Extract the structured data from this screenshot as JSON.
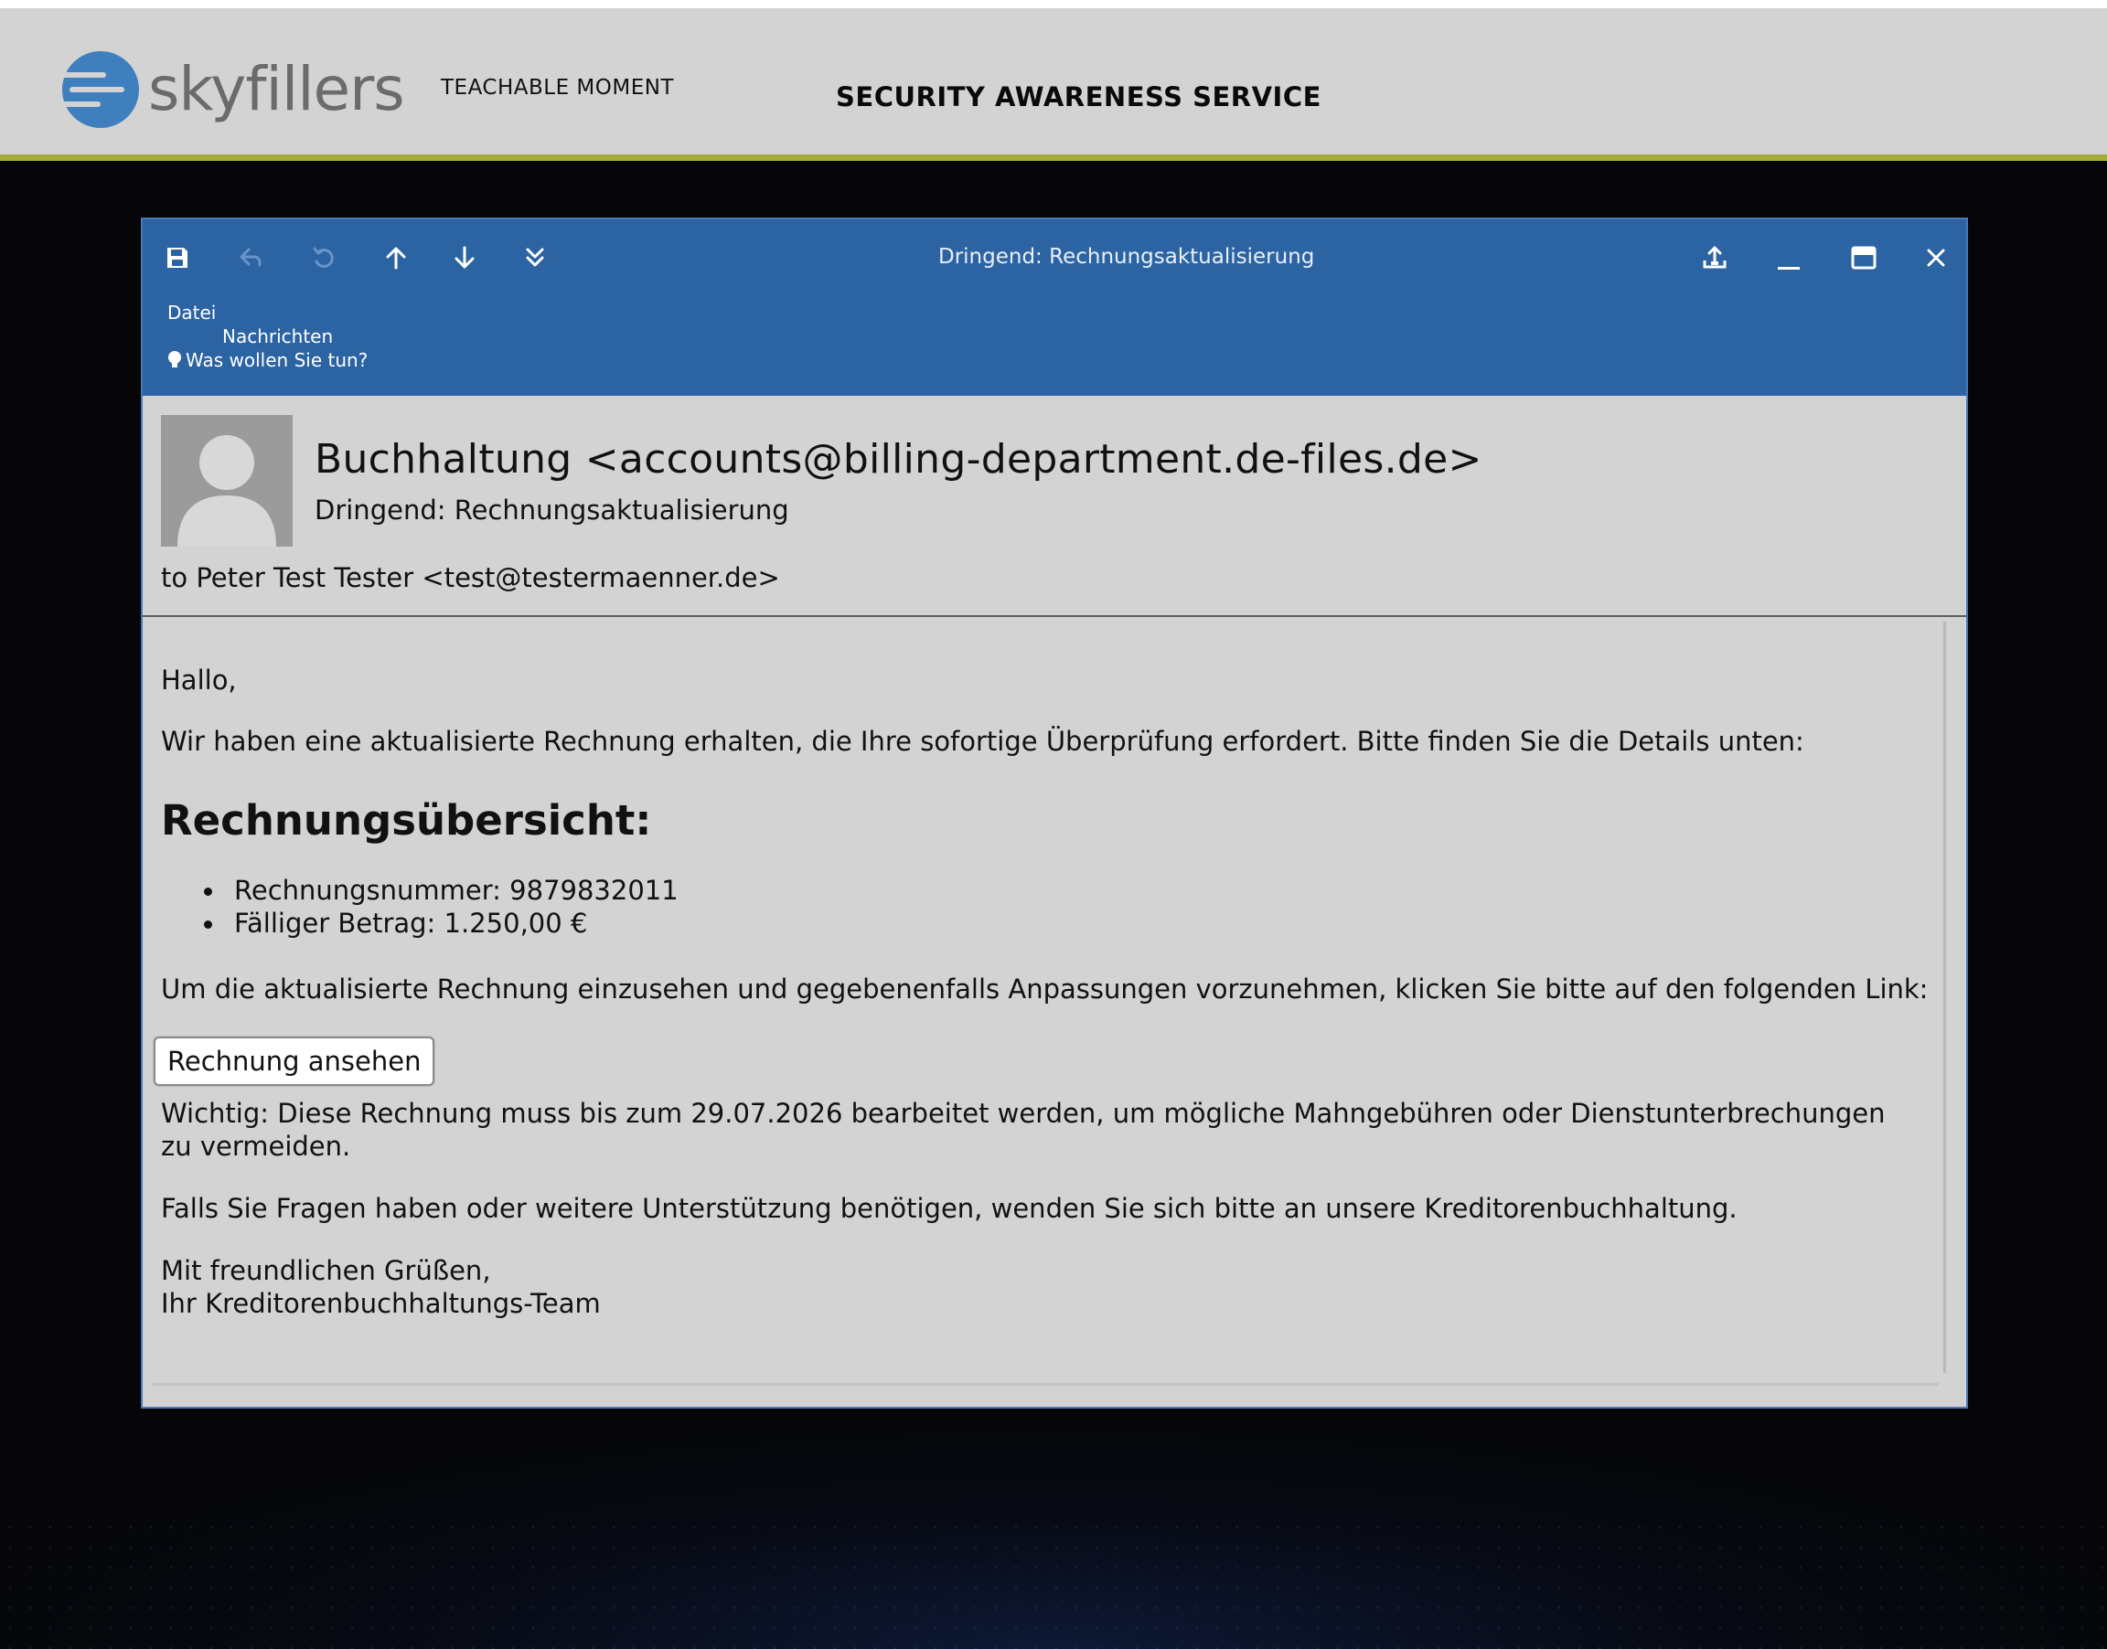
{
  "header": {
    "logo_text": "skyfillers",
    "teachable_moment": "TEACHABLE MOMENT",
    "service_title": "SECURITY AWARENESS SERVICE",
    "accent_color": "#a4ad3a",
    "logo_color": "#3f7fbe"
  },
  "window": {
    "title": "Dringend: Rechnungsaktualisierung",
    "toolbar_icons": [
      "save-icon",
      "undo-icon",
      "redo-icon",
      "arrow-up-icon",
      "arrow-down-icon",
      "double-chevron-down-icon"
    ],
    "window_icons": [
      "share-icon",
      "minimize-icon",
      "maximize-icon",
      "close-icon"
    ],
    "menu": {
      "file": "Datei",
      "messages": "Nachrichten",
      "tell_me": "Was wollen Sie tun?"
    },
    "titlebar_color": "#2c64a3"
  },
  "message": {
    "from": "Buchhaltung <accounts@billing-department.de-files.de>",
    "subject": "Dringend: Rechnungsaktualisierung",
    "to": "to Peter Test Tester <test@testermaenner.de>"
  },
  "body": {
    "greeting": "Hallo,",
    "intro": "Wir haben eine aktualisierte Rechnung erhalten, die Ihre sofortige Überprüfung erfordert. Bitte finden Sie die Details unten:",
    "heading": "Rechnungsübersicht:",
    "items": [
      "Rechnungsnummer: 9879832011",
      "Fälliger Betrag: 1.250,00 €"
    ],
    "cta_text": "Um die aktualisierte Rechnung einzusehen und gegebenenfalls Anpassungen vorzunehmen, klicken Sie bitte auf den folgenden Link:",
    "button_label": "Rechnung ansehen",
    "important": "Wichtig: Diese Rechnung muss bis zum 29.07.2026 bearbeitet werden, um mögliche Mahngebühren oder Dienstunterbrechungen zu vermeiden.",
    "questions": "Falls Sie Fragen haben oder weitere Unterstützung benötigen, wenden Sie sich bitte an unsere Kreditorenbuchhaltung.",
    "closing": "Mit freundlichen Grüßen,",
    "signature": "Ihr Kreditorenbuchhaltungs-Team"
  }
}
